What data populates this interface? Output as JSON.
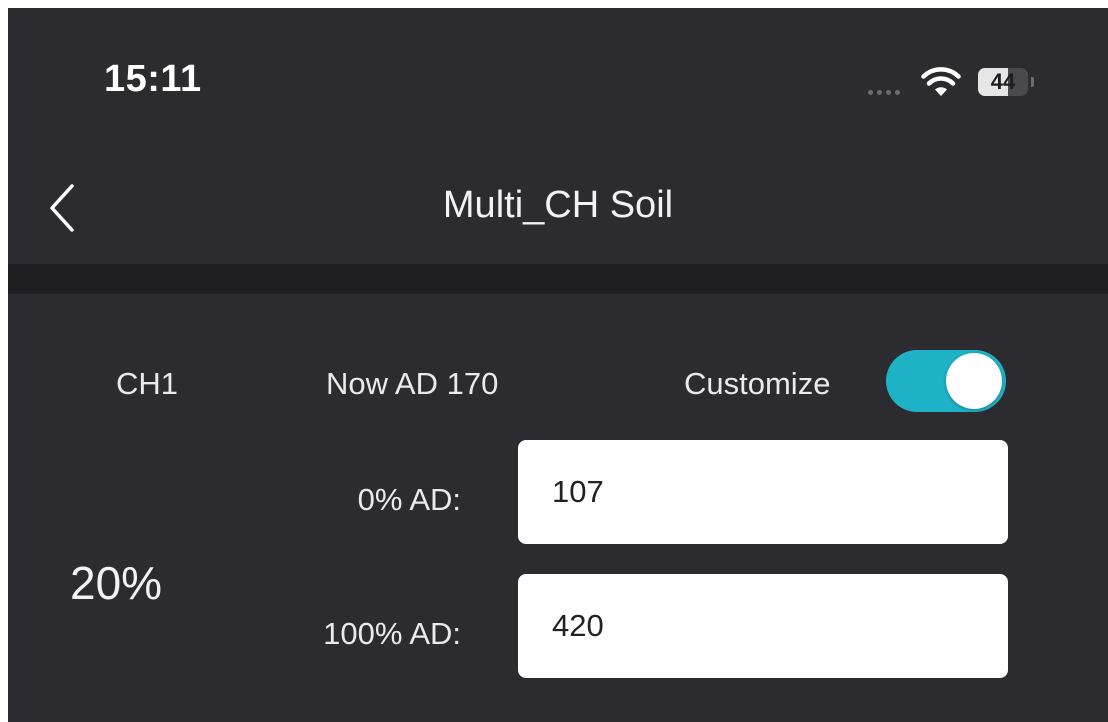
{
  "status_bar": {
    "time": "15:11",
    "battery_level": "44",
    "battery_fraction": 0.6,
    "signal_icon": "signal-dots-icon",
    "wifi_icon": "wifi-icon"
  },
  "nav": {
    "back_icon": "chevron-left-icon",
    "title": "Multi_CH Soil"
  },
  "channel": {
    "name": "CH1",
    "now_ad": "Now AD 170",
    "customize_label": "Customize",
    "customize_enabled": true,
    "moisture_percent": "20%",
    "zero_label": "0% AD:",
    "zero_value": "107",
    "full_label": "100% AD:",
    "full_value": "420"
  },
  "colors": {
    "background": "#2c2c30",
    "divider": "#1e1e21",
    "accent": "#1eb2c6",
    "input_background": "#ffffff"
  }
}
